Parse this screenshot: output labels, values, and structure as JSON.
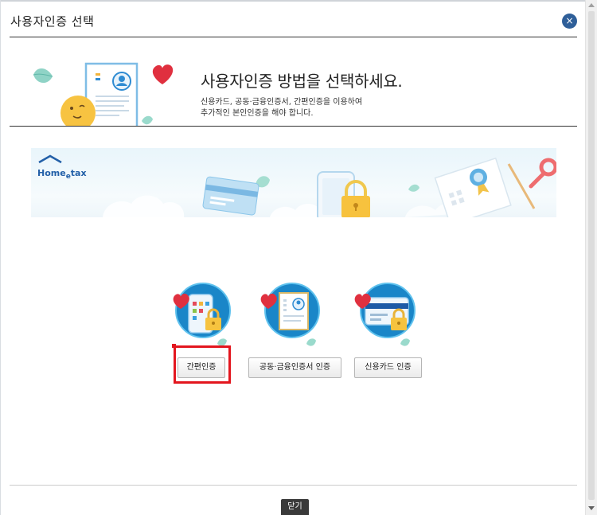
{
  "dialog": {
    "title": "사용자인증 선택",
    "close_icon": "×"
  },
  "hero": {
    "heading": "사용자인증 방법을 선택하세요.",
    "desc_line1": "신용카드, 공동·금융인증서, 간편인증을 이용하여",
    "desc_line2": "추가적인 본인인증을 해야 합니다."
  },
  "banner": {
    "logo_home": "Home",
    "logo_e": "e",
    "logo_tax": "tax"
  },
  "methods": [
    {
      "label": "간편인증",
      "icon": "mobile-lock-icon"
    },
    {
      "label": "공동·금융인증서 인증",
      "icon": "certificate-icon"
    },
    {
      "label": "신용카드 인증",
      "icon": "credit-card-lock-icon"
    }
  ],
  "footer": {
    "close_label": "닫기"
  },
  "colors": {
    "highlight": "#e3161e",
    "close_button": "#2f5f99",
    "footer_button": "#3a3a3a",
    "icon_blue": "#1a86c8"
  }
}
